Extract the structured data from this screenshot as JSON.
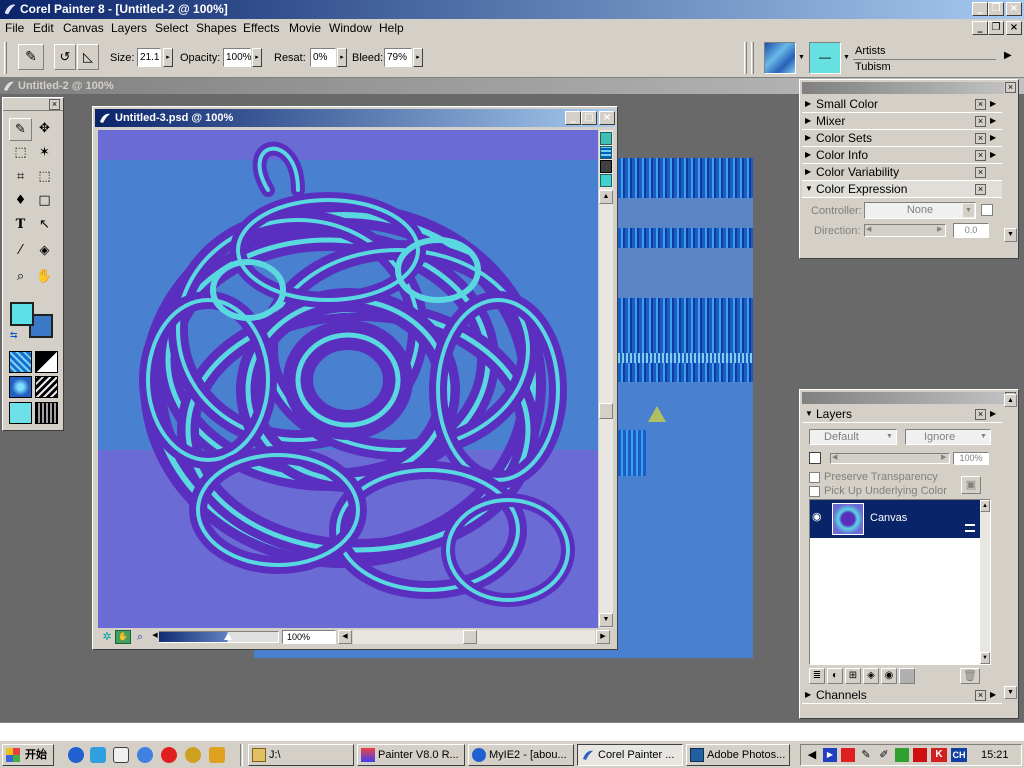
{
  "window": {
    "title": "Corel Painter 8 - [Untitled-2 @ 100%]"
  },
  "menu": [
    "File",
    "Edit",
    "Canvas",
    "Layers",
    "Select",
    "Shapes",
    "Effects",
    "Movie",
    "Window",
    "Help"
  ],
  "property_bar": {
    "size_label": "Size:",
    "size_value": "21.1",
    "opacity_label": "Opacity:",
    "opacity_value": "100%",
    "resat_label": "Resat:",
    "resat_value": "0%",
    "bleed_label": "Bleed:",
    "bleed_value": "79%",
    "brush_category": "Artists",
    "brush_variant": "Tubism"
  },
  "background_document": {
    "title": "Untitled-2 @ 100%"
  },
  "document": {
    "title": "Untitled-3.psd @ 100%",
    "zoom": "100%"
  },
  "panels": {
    "items": [
      "Small Color",
      "Mixer",
      "Color Sets",
      "Color Info",
      "Color Variability",
      "Color Expression"
    ],
    "color_expression": {
      "controller_label": "Controller:",
      "controller_value": "None",
      "direction_label": "Direction:",
      "direction_value": "0.0"
    }
  },
  "layers": {
    "title": "Layers",
    "composite_method": "Default",
    "composite_depth": "Ignore",
    "opacity": "100%",
    "preserve_transparency": "Preserve Transparency",
    "pick_up_underlying": "Pick Up Underlying Color",
    "canvas_layer": "Canvas",
    "channels_title": "Channels"
  },
  "taskbar": {
    "start_label": "开始",
    "tasks": [
      "J:\\",
      "Painter V8.0 R...",
      "MyIE2 - [abou...",
      "Corel Painter ...",
      "Adobe Photos..."
    ],
    "tray_ime": "CH",
    "clock": "15:21"
  },
  "colors": {
    "title_active_start": "#0a246a",
    "title_active_end": "#a6caf0",
    "workspace": "#696969",
    "canvas_bg": "#6b6bd6",
    "stroke_light": "#5ad8e0",
    "stroke_dark": "#5a2fc0",
    "primary_color": "#5ee0e8",
    "secondary_color": "#3a78c8"
  }
}
